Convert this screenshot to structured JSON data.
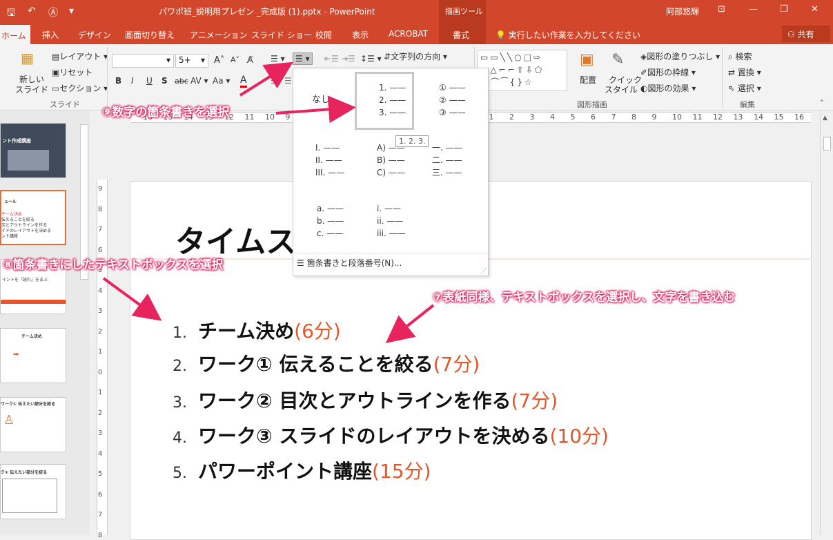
{
  "window": {
    "title": "パワポ班_説明用プレゼン _完成版 (1).pptx - PowerPoint",
    "context_tab_group": "描画ツール",
    "user": "阿部悠輝",
    "share": "共有"
  },
  "tabs": [
    "ホーム",
    "挿入",
    "デザイン",
    "画面切り替え",
    "アニメーション",
    "スライド ショー",
    "校閲",
    "表示",
    "ACROBAT",
    "書式"
  ],
  "tell_me": "実行したい作業を入力してください",
  "ribbon": {
    "slides_group": {
      "new_slide": "新しい",
      "new_slide2": "スライド",
      "layout": "レイアウト",
      "reset": "リセット",
      "section": "セクション",
      "label": "スライド"
    },
    "font": {
      "size": "5+"
    },
    "text_direction": "文字列の方向",
    "drawing": {
      "arrange": "配置",
      "quick_style": "クイック",
      "quick_style2": "スタイル",
      "fill": "図形の塗りつぶし",
      "outline": "図形の枠線",
      "effect": "図形の効果",
      "label": "図形描画"
    },
    "editing": {
      "find": "検索",
      "replace": "置換",
      "select": "選択",
      "label": "編集"
    }
  },
  "ruler": [
    "16",
    "15",
    "14",
    "13",
    "12",
    "11",
    "10",
    "9",
    "8",
    "7",
    "6",
    "5",
    "4",
    "3",
    "2",
    "1",
    "0",
    "1",
    "2",
    "3",
    "4",
    "5",
    "6",
    "7",
    "8",
    "9",
    "10",
    "11",
    "12",
    "13",
    "14",
    "15",
    "16"
  ],
  "vruler": [
    "9",
    "8",
    "7",
    "6",
    "5",
    "4",
    "3",
    "2",
    "1",
    "0",
    "1",
    "2",
    "3",
    "4",
    "5",
    "6",
    "7",
    "8"
  ],
  "numbering_dropdown": {
    "none": "なし",
    "arabic": [
      "1. ——",
      "2. ——",
      "3. ——"
    ],
    "circled": [
      "① ——",
      "② ——",
      "③ ——"
    ],
    "roman": [
      "I. ——",
      "II. ——",
      "III. ——"
    ],
    "alpha_paren": [
      "A) ——",
      "B) ——",
      "C) ——"
    ],
    "kanji": [
      "一. ——",
      "二. ——",
      "三. ——"
    ],
    "lower_alpha": [
      "a. ——",
      "b. ——",
      "c. ——"
    ],
    "lower_roman": [
      "i. ——",
      "ii. ——",
      "iii. ——"
    ],
    "tooltip": "1. 2. 3.",
    "footer": "箇条書きと段落番号(N)..."
  },
  "slide": {
    "title": "タイムス",
    "agenda": [
      {
        "num": "1.",
        "text": "チーム決め",
        "time": "(6分)"
      },
      {
        "num": "2.",
        "text": "ワーク① 伝えることを絞る",
        "time": "(7分)"
      },
      {
        "num": "3.",
        "text": "ワーク② 目次とアウトラインを作る",
        "time": "(7分)"
      },
      {
        "num": "4.",
        "text": "ワーク③ スライドのレイアウトを決める",
        "time": "(10分)"
      },
      {
        "num": "5.",
        "text": "パワーポイント講座",
        "time": "(15分)"
      }
    ]
  },
  "thumbnails": {
    "t1": "ント作成講座",
    "t2_title": "ュール",
    "t2_lines": [
      "チーム決め",
      "伝えることを絞る",
      "次とアウトラインを作る",
      "イドのレイアウトを決める",
      "ント講座"
    ],
    "t3": "イントを「読れ」をまぶ",
    "t4": "チーム決め",
    "t5": "ワーク① 伝えたい部分を絞る",
    "t6": "ク① 伝えたい部分を絞る"
  },
  "callouts": {
    "c9": "⑨数字の箇条書きを選択",
    "c8": "⑧箇条書きにしたテキストボックスを選択",
    "c7": "⑦表紙同様、テキストボックスを選択し、文字を書き込む"
  },
  "colors": {
    "accent": "#d2472b",
    "time_text": "#e0582a",
    "callout_glow": "#e0245e"
  }
}
